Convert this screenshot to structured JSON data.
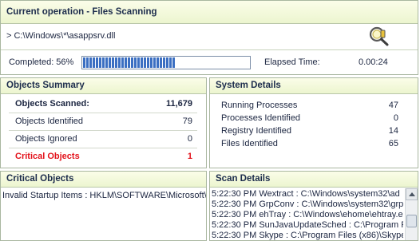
{
  "operation": {
    "title": "Current operation - Files Scanning",
    "path": "> C:\\Windows\\*\\asappsrv.dll",
    "completed_label": "Completed: 56%",
    "progress_fraction": 0.56,
    "elapsed_label": "Elapsed Time:",
    "elapsed_value": "0.00:24",
    "icon": "magnifier-icon"
  },
  "summary": {
    "title": "Objects Summary",
    "rows": [
      {
        "label": "Objects Scanned:",
        "value": "11,679"
      },
      {
        "label": "Objects Identified",
        "value": "79"
      },
      {
        "label": "Objects Ignored",
        "value": "0"
      },
      {
        "label": "Critical Objects",
        "value": "1"
      }
    ],
    "critical_color": "#e3121b"
  },
  "system": {
    "title": "System Details",
    "rows": [
      {
        "label": "Running Processes",
        "value": "47"
      },
      {
        "label": "Processes Identified",
        "value": "0"
      },
      {
        "label": "Registry Identified",
        "value": "14"
      },
      {
        "label": "Files Identified",
        "value": "65"
      }
    ]
  },
  "critical": {
    "title": "Critical Objects",
    "line": "Invalid Startup Items : HKLM\\SOFTWARE\\Microsoft\\W"
  },
  "scan": {
    "title": "Scan Details",
    "lines": [
      "5:22:30 PM Wextract : C:\\Windows\\system32\\ad",
      "5:22:30 PM GrpConv : C:\\Windows\\system32\\grp",
      "5:22:30 PM ehTray : C:\\Windows\\ehome\\ehtray.e",
      "5:22:30 PM SunJavaUpdateSched : C:\\Program Fi",
      "5:22:30 PM Skype : C:\\Program Files (x86)\\Skype"
    ]
  },
  "colors": {
    "accent": "#3b6fc2",
    "header_bg": "#ecf5cf"
  }
}
